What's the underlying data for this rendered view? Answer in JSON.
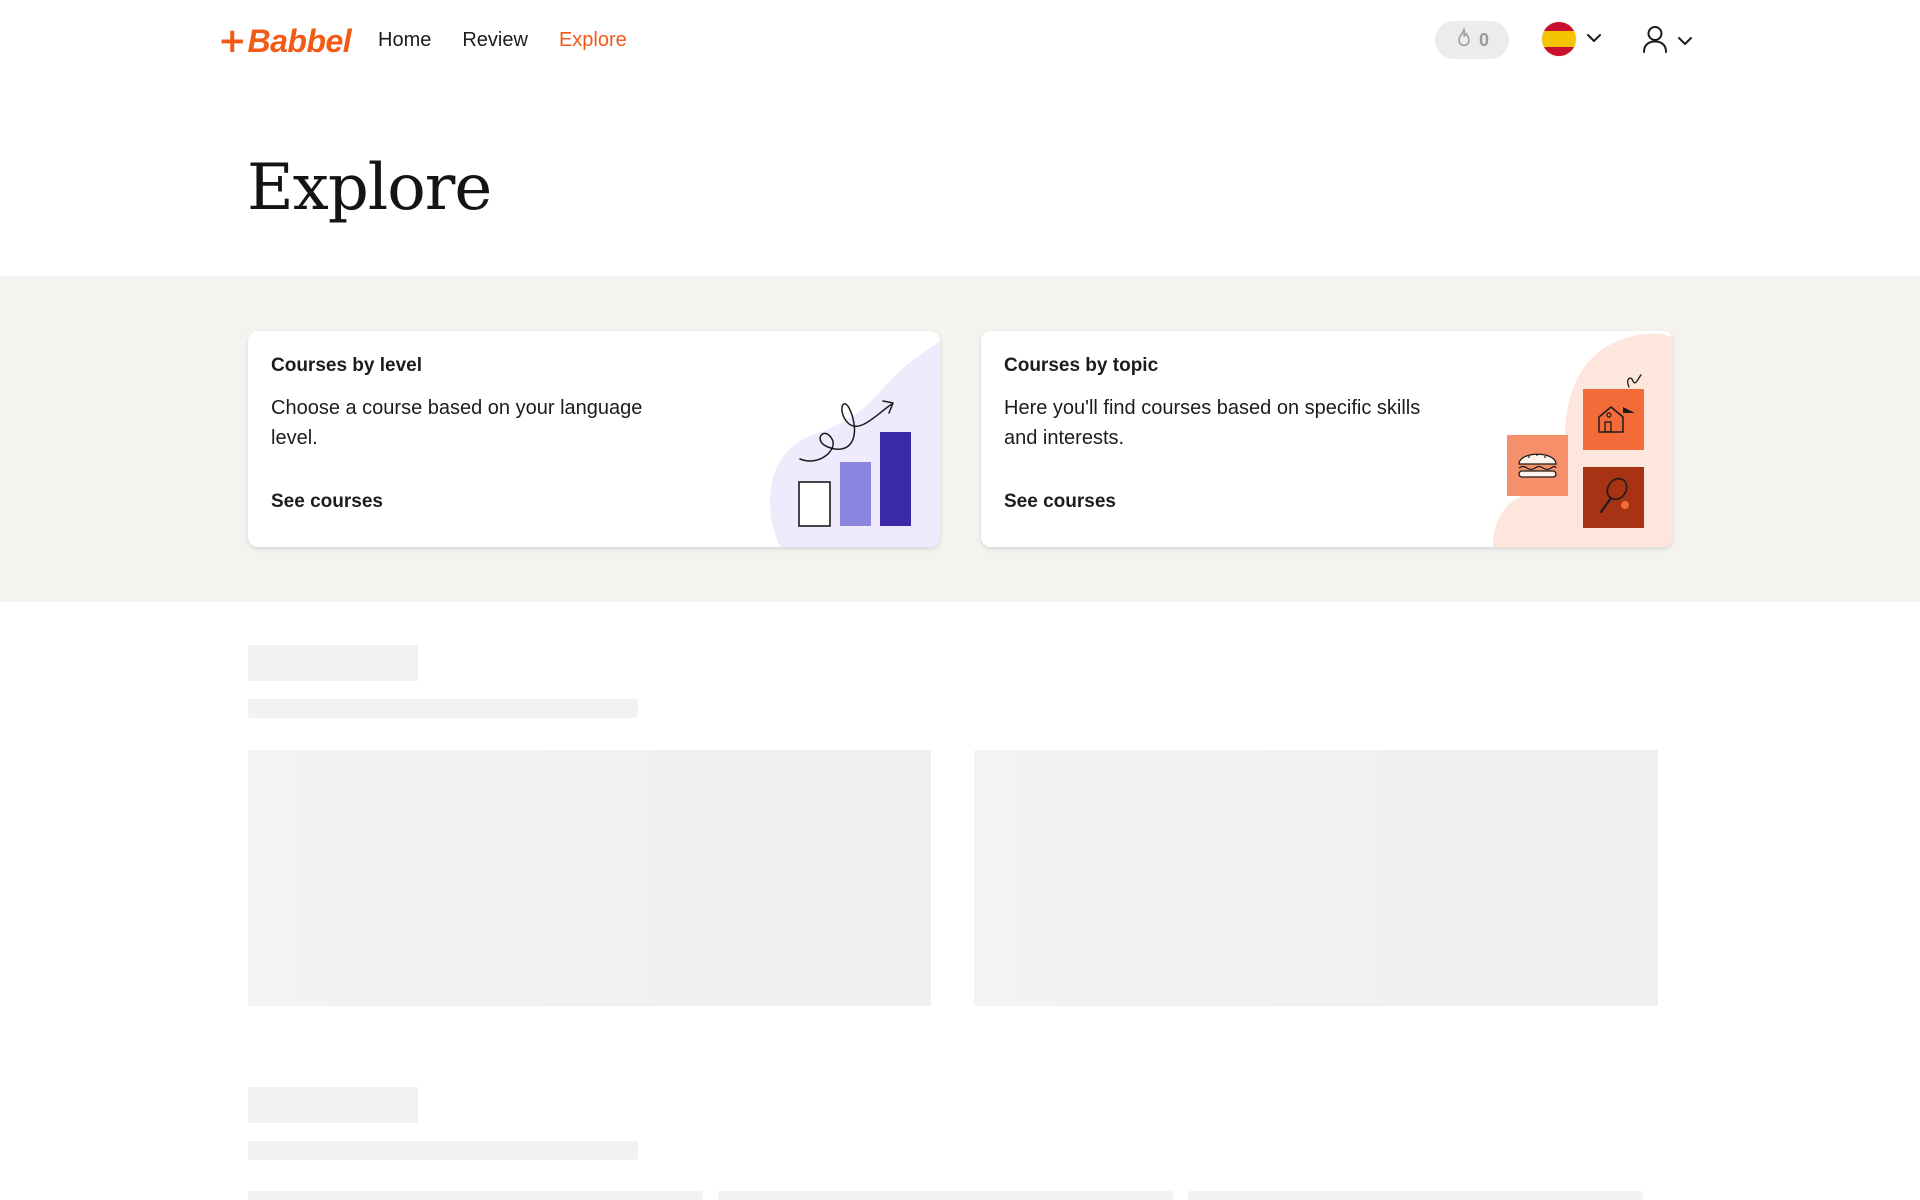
{
  "header": {
    "logo_plus": "+",
    "logo_text": "Babbel",
    "nav": [
      {
        "label": "Home",
        "active": false
      },
      {
        "label": "Review",
        "active": false
      },
      {
        "label": "Explore",
        "active": true
      }
    ],
    "streak_count": "0",
    "language_flag": "spain-flag-icon",
    "user_icon": "user-icon"
  },
  "page": {
    "title": "Explore"
  },
  "cards": [
    {
      "title": "Courses by level",
      "description": "Choose a course based on your language level.",
      "link": "See courses",
      "illustration": "level-bars-illustration"
    },
    {
      "title": "Courses by topic",
      "description": "Here you'll find courses based on specific skills and interests.",
      "link": "See courses",
      "illustration": "topic-tiles-illustration"
    }
  ],
  "colors": {
    "brand_orange": "#f25a16",
    "band_background": "#f4f3ef",
    "level_blob": "#efeafc",
    "topic_blob": "#fde6dc"
  }
}
